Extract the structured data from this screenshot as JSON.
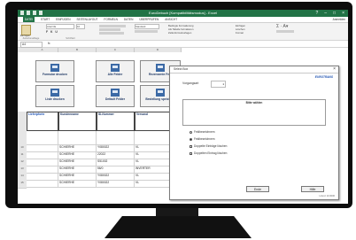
{
  "app": {
    "title": "EuroDebuch [Kompatibilitätsmodus] - Excel",
    "signin": "Anmelden"
  },
  "window_controls": [
    "?",
    "–",
    "□",
    "×"
  ],
  "ribbon_tabs": [
    {
      "label": "DATEI",
      "active": true
    },
    {
      "label": "START",
      "active": false
    },
    {
      "label": "EINFÜGEN",
      "active": false
    },
    {
      "label": "SEITENLAYOUT",
      "active": false
    },
    {
      "label": "FORMELN",
      "active": false
    },
    {
      "label": "DATEN",
      "active": false
    },
    {
      "label": "ÜBERPRÜFEN",
      "active": false
    },
    {
      "label": "ANSICHT",
      "active": false
    }
  ],
  "ribbon": {
    "clipboard_label": "Zwischenablage",
    "paste_label": "Einfügen",
    "font_name": "Arial CE",
    "font_size": "10",
    "font_label": "Schriftart",
    "number_format": "Standard",
    "cond_format": "Bedingte Formatierung",
    "as_table": "Als Tabelle formatieren",
    "cell_styles": "Zellenformatvorlagen",
    "insert": "Einfügen",
    "delete": "Löschen",
    "format": "Format"
  },
  "formula_bar": {
    "name_box": "A4",
    "fx": "fx"
  },
  "columns": [
    "A",
    "B",
    "C",
    "D"
  ],
  "buttons": [
    {
      "label": "Formular drucken"
    },
    {
      "label": "Alle Felder"
    },
    {
      "label": "Rezensente Feld"
    },
    {
      "label": "Liste drucken"
    },
    {
      "label": "Default Felder"
    },
    {
      "label": "Bestellung speichern"
    }
  ],
  "table": {
    "headers": [
      "Lieferpforte",
      "Kundenname",
      "ID-Nummer",
      "Versand"
    ],
    "row_numbers": [
      "",
      "",
      "",
      "",
      "10",
      "11",
      "12",
      "13",
      "14",
      "15"
    ],
    "rows": [
      [
        "",
        "SCHIERHE",
        "Y080022",
        "VL"
      ],
      [
        "",
        "SCHIERHE",
        "22022",
        "VL"
      ],
      [
        "",
        "SCHIERHE",
        "S51002",
        "VL"
      ],
      [
        "",
        "SCHIERHE",
        "56/0",
        "INVERTER"
      ],
      [
        "",
        "SCHIERHE",
        "Y080022",
        "VL"
      ],
      [
        "",
        "SCHIERHE",
        "Y080022",
        "VL"
      ]
    ]
  },
  "dialog": {
    "title": "Select Box",
    "brand": "EUROTRANS",
    "field_label": "Vorgangsart",
    "field_value": "1",
    "list_header": "Bitte wählen",
    "options": [
      {
        "label": "Feldbezeichnern",
        "kind": "radio",
        "selected": false
      },
      {
        "label": "Feldbezeichnern",
        "kind": "radio",
        "selected": true
      },
      {
        "label": "Doppelte Einträge löschen",
        "kind": "check",
        "selected": false
      },
      {
        "label": "Doppelten Eintrag löschen",
        "kind": "check",
        "selected": false
      }
    ],
    "ok_label": "Ende",
    "cancel_label": "Hilfe",
    "footer": "Lizenz 10.0006"
  },
  "colors": {
    "excel_green": "#217346",
    "button_text": "#1f3864",
    "link_blue": "#1a4fb0"
  }
}
